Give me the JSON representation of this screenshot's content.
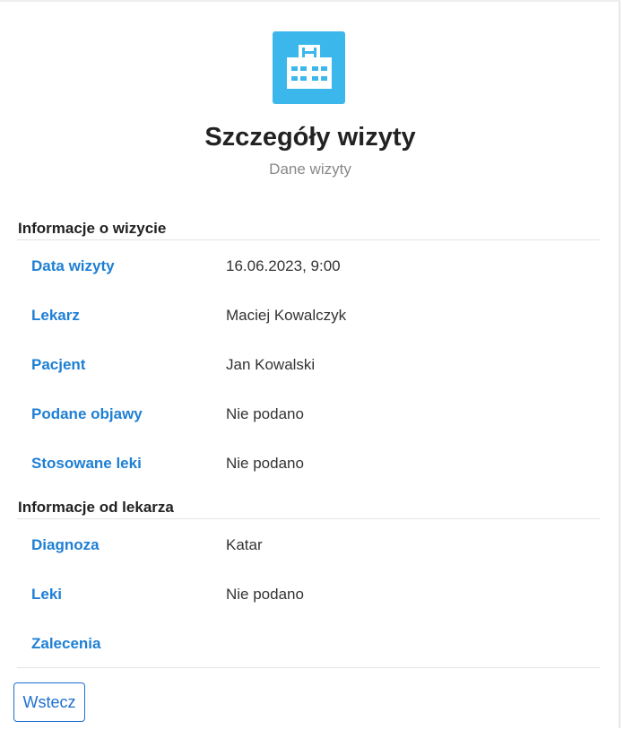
{
  "header": {
    "logo_icon": "hospital-icon",
    "title": "Szczegóły wizyty",
    "subtitle": "Dane wizyty"
  },
  "visit_info": {
    "heading": "Informacje o wizycie",
    "rows": [
      {
        "label": "Data wizyty",
        "value": "16.06.2023, 9:00"
      },
      {
        "label": "Lekarz",
        "value": "Maciej Kowalczyk"
      },
      {
        "label": "Pacjent",
        "value": "Jan Kowalski"
      },
      {
        "label": "Podane objawy",
        "value": "Nie podano"
      },
      {
        "label": "Stosowane leki",
        "value": "Nie podano"
      }
    ]
  },
  "doctor_info": {
    "heading": "Informacje od lekarza",
    "rows": [
      {
        "label": "Diagnoza",
        "value": "Katar"
      },
      {
        "label": "Leki",
        "value": "Nie podano"
      },
      {
        "label": "Zalecenia",
        "value": ""
      }
    ]
  },
  "actions": {
    "back_label": "Wstecz"
  },
  "colors": {
    "accent": "#1e7fd4",
    "logo_bg": "#3cb7ec",
    "button_border": "#1e6fcf"
  }
}
